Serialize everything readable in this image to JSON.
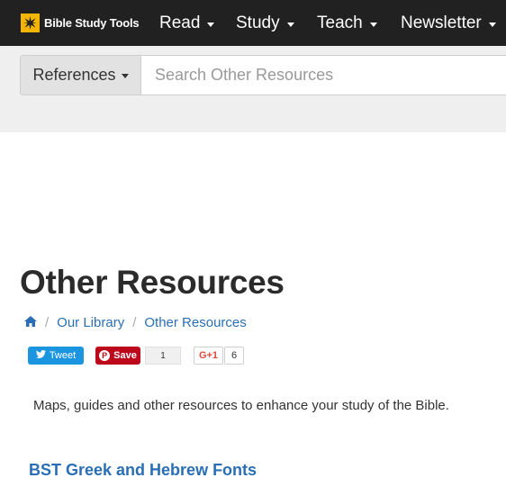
{
  "brand": {
    "name": "Bible Study Tools",
    "accent": "#f5b400"
  },
  "nav": {
    "items": [
      {
        "label": "Read"
      },
      {
        "label": "Study"
      },
      {
        "label": "Teach"
      },
      {
        "label": "Newsletter"
      }
    ]
  },
  "search": {
    "scope_label": "References",
    "placeholder": "Search Other Resources",
    "value": ""
  },
  "page": {
    "title": "Other Resources",
    "breadcrumb": [
      "Our Library",
      "Other Resources"
    ],
    "description": "Maps, guides and other resources to enhance your study of the Bible.",
    "section_link": "BST Greek and Hebrew Fonts"
  },
  "share": {
    "tweet_label": "Tweet",
    "save_label": "Save",
    "save_count": "1",
    "gplus_label": "G+1",
    "gplus_count": "6"
  },
  "icons": {
    "home": "home-icon",
    "twitter": "twitter-bird-icon",
    "pinterest": "pinterest-icon"
  }
}
